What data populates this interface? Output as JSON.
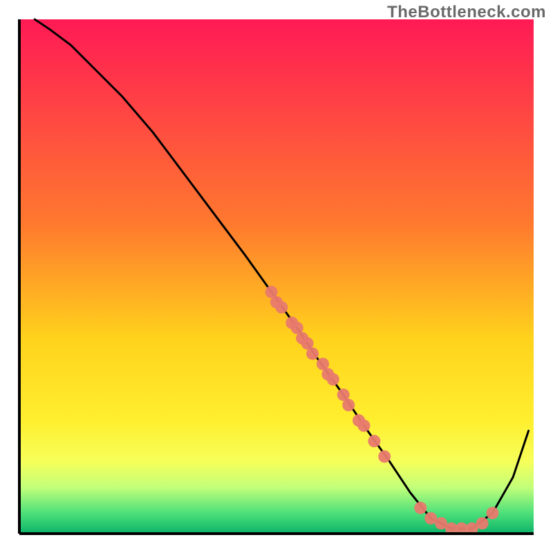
{
  "watermark": "TheBottleneck.com",
  "chart_data": {
    "type": "line",
    "title": "",
    "xlabel": "",
    "ylabel": "",
    "xlim": [
      0,
      100
    ],
    "ylim": [
      0,
      100
    ],
    "background_gradient_stops": [
      {
        "offset": 0.0,
        "color": "#ff1a55"
      },
      {
        "offset": 0.4,
        "color": "#ff7a2e"
      },
      {
        "offset": 0.62,
        "color": "#ffd21c"
      },
      {
        "offset": 0.78,
        "color": "#ffef2e"
      },
      {
        "offset": 0.86,
        "color": "#f6ff5a"
      },
      {
        "offset": 0.91,
        "color": "#c2ff7a"
      },
      {
        "offset": 0.96,
        "color": "#4de07a"
      },
      {
        "offset": 1.0,
        "color": "#0cb36a"
      }
    ],
    "series": [
      {
        "name": "bottleneck-curve",
        "x": [
          3,
          6,
          10,
          14,
          20,
          26,
          32,
          38,
          44,
          49,
          54,
          58,
          63,
          67,
          72,
          76,
          80,
          84,
          88,
          92,
          96,
          99
        ],
        "y": [
          100,
          98,
          95,
          91,
          85,
          78,
          70,
          62,
          54,
          47,
          40,
          34,
          27,
          21,
          14,
          8,
          3,
          1,
          1,
          4,
          11,
          20
        ]
      }
    ],
    "scatter_points": {
      "name": "highlighted-configs",
      "xy": [
        [
          49,
          47
        ],
        [
          50,
          45
        ],
        [
          51,
          44
        ],
        [
          53,
          41
        ],
        [
          54,
          40
        ],
        [
          55,
          38
        ],
        [
          56,
          37
        ],
        [
          57,
          35
        ],
        [
          59,
          33
        ],
        [
          60,
          31
        ],
        [
          61,
          30
        ],
        [
          63,
          27
        ],
        [
          64,
          25
        ],
        [
          66,
          22
        ],
        [
          67,
          21
        ],
        [
          69,
          18
        ],
        [
          71,
          15
        ],
        [
          78,
          5
        ],
        [
          80,
          3
        ],
        [
          82,
          2
        ],
        [
          84,
          1
        ],
        [
          86,
          1
        ],
        [
          88,
          1
        ],
        [
          90,
          2
        ],
        [
          92,
          4
        ]
      ]
    }
  }
}
